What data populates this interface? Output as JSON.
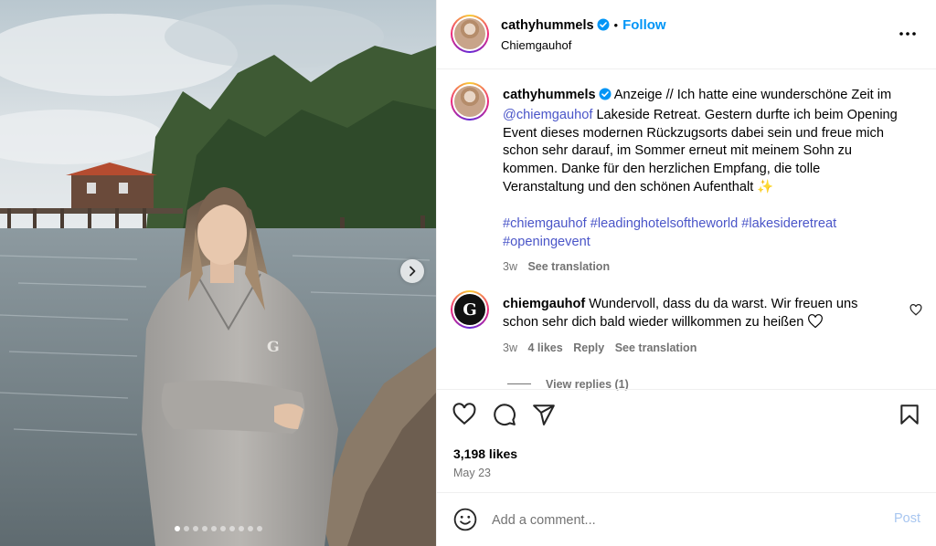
{
  "header": {
    "username": "cathyhummels",
    "separator": "•",
    "follow_label": "Follow",
    "location": "Chiemgauhof",
    "more_icon": "more-horizontal-icon"
  },
  "caption": {
    "username": "cathyhummels",
    "text_part1": "Anzeige // Ich hatte eine wunderschöne Zeit im ",
    "mention": "@chiemgauhof",
    "text_part2": " Lakeside Retreat. Gestern durfte ich beim Opening Event dieses modernen Rückzugsorts dabei sein und freue mich schon sehr darauf, im Sommer erneut mit meinem Sohn zu kommen. Danke für den herzlichen Empfang, die tolle Veranstaltung und den schönen Aufenthalt ",
    "emoji": "✨",
    "hashtags": [
      "#chiemgauhof",
      "#leadinghotelsoftheworld",
      "#lakesideretreat",
      "#openingevent"
    ],
    "age": "3w",
    "see_translation": "See translation"
  },
  "comment": {
    "username": "chiemgauhof",
    "avatar_letter": "G",
    "text": "Wundervoll, dass du da warst. Wir freuen uns schon sehr dich bald wieder willkommen zu heißen",
    "age": "3w",
    "likes": "4 likes",
    "reply_label": "Reply",
    "see_translation": "See translation",
    "view_replies": "View replies (1)"
  },
  "actions": {
    "likes_count": "3,198 likes",
    "date": "May 23"
  },
  "composer": {
    "placeholder": "Add a comment...",
    "post_label": "Post"
  },
  "carousel": {
    "total_slides": 10,
    "active_index": 0
  },
  "colors": {
    "accent": "#0095f6",
    "verified": "#0095f6",
    "hashtag": "#4a55c8",
    "muted": "#737373",
    "post_disabled": "#a8c6f0"
  }
}
